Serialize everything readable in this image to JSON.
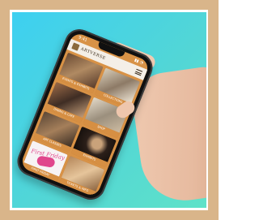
{
  "app": {
    "status_time": "9:41",
    "status_icons": "▮▮ ◔",
    "brand": "ARTVERSE",
    "menu_icon": "hamburger-menu-icon"
  },
  "tiles": [
    {
      "caption": "EVENTS & EXHIBITS",
      "image": "gallery-photo"
    },
    {
      "caption": "COLLECTIONS",
      "image": "gallery-photo"
    },
    {
      "caption": "DINING & CAFE",
      "image": "gallery-photo"
    },
    {
      "caption": "SHOP",
      "image": "gallery-photo"
    },
    {
      "caption": "ART CLASSES",
      "image": "gallery-photo"
    },
    {
      "caption": "EXHIBITS",
      "image": "portrait-painting"
    },
    {
      "caption": "FIRST FRIDAY",
      "image": "poster"
    },
    {
      "caption": "TICKETS & INFO",
      "image": "gallery-photo"
    }
  ],
  "poster_text": "First Friday",
  "colors": {
    "background_gradient_start": "#3dd0f1",
    "background_gradient_end": "#5fe2c8",
    "frame_border": "#d9b58a",
    "tile_caption": "#d68f43",
    "nail_polish": "#d33e67"
  }
}
